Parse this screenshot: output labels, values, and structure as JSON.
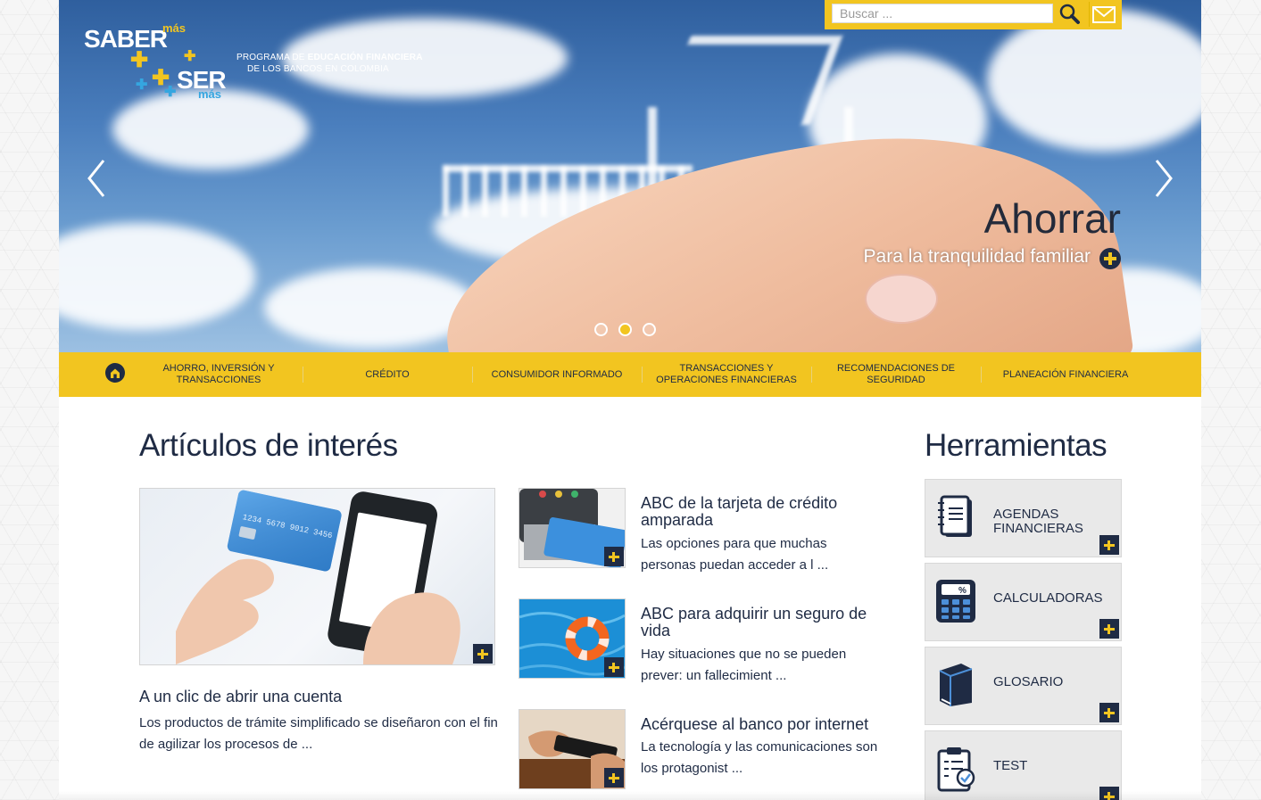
{
  "header": {
    "logo": {
      "saber": "SABER",
      "mas_top": "más",
      "ser": "SER",
      "mas_bottom": "más"
    },
    "program_line1_prefix": "PROGRAMA DE ",
    "program_line1_bold": "EDUCACIÓN FINANCIERA",
    "program_line2": "DE LOS BANCOS EN COLOMBIA",
    "search_placeholder": "Buscar ...",
    "search_icon": "magnifier-icon",
    "mail_icon": "envelope-icon"
  },
  "slider": {
    "title": "Ahorrar",
    "subtitle": "Para la tranquilidad familiar",
    "dots": [
      {
        "active": false
      },
      {
        "active": true
      },
      {
        "active": false
      }
    ],
    "prev_icon": "chevron-left-icon",
    "next_icon": "chevron-right-icon"
  },
  "nav": {
    "home_icon": "home-icon",
    "items": [
      {
        "label": "AHORRO, INVERSIÓN Y TRANSACCIONES"
      },
      {
        "label": "CRÉDITO"
      },
      {
        "label": "CONSUMIDOR INFORMADO"
      },
      {
        "label": "TRANSACCIONES Y OPERACIONES FINANCIERAS"
      },
      {
        "label": "RECOMENDACIONES DE SEGURIDAD"
      },
      {
        "label": "PLANEACIÓN FINANCIERA"
      }
    ]
  },
  "articles": {
    "heading": "Artículos de interés",
    "featured": {
      "title": "A un clic de abrir una cuenta",
      "desc": "Los productos de trámite simplificado se diseñaron con el fin de agilizar los procesos de ..."
    },
    "list": [
      {
        "title": "ABC de la tarjeta de crédito amparada",
        "desc": "Las opciones para que muchas personas puedan acceder a l ..."
      },
      {
        "title": "ABC para adquirir un seguro de vida",
        "desc": "Hay situaciones que no se pueden prever: un fallecimient ..."
      },
      {
        "title": "Acérquese al banco por internet",
        "desc": "La tecnología y las comunicaciones son los protagonist ..."
      }
    ]
  },
  "tools": {
    "heading": "Herramientas",
    "items": [
      {
        "label": "AGENDAS FINANCIERAS",
        "icon": "notebook-icon"
      },
      {
        "label": "CALCULADORAS",
        "icon": "calculator-icon"
      },
      {
        "label": "GLOSARIO",
        "icon": "book-icon"
      },
      {
        "label": "TEST",
        "icon": "clipboard-icon"
      }
    ]
  },
  "colors": {
    "brand_yellow": "#f2c520",
    "brand_navy": "#1f2b44",
    "brand_blue": "#35a6e0"
  }
}
